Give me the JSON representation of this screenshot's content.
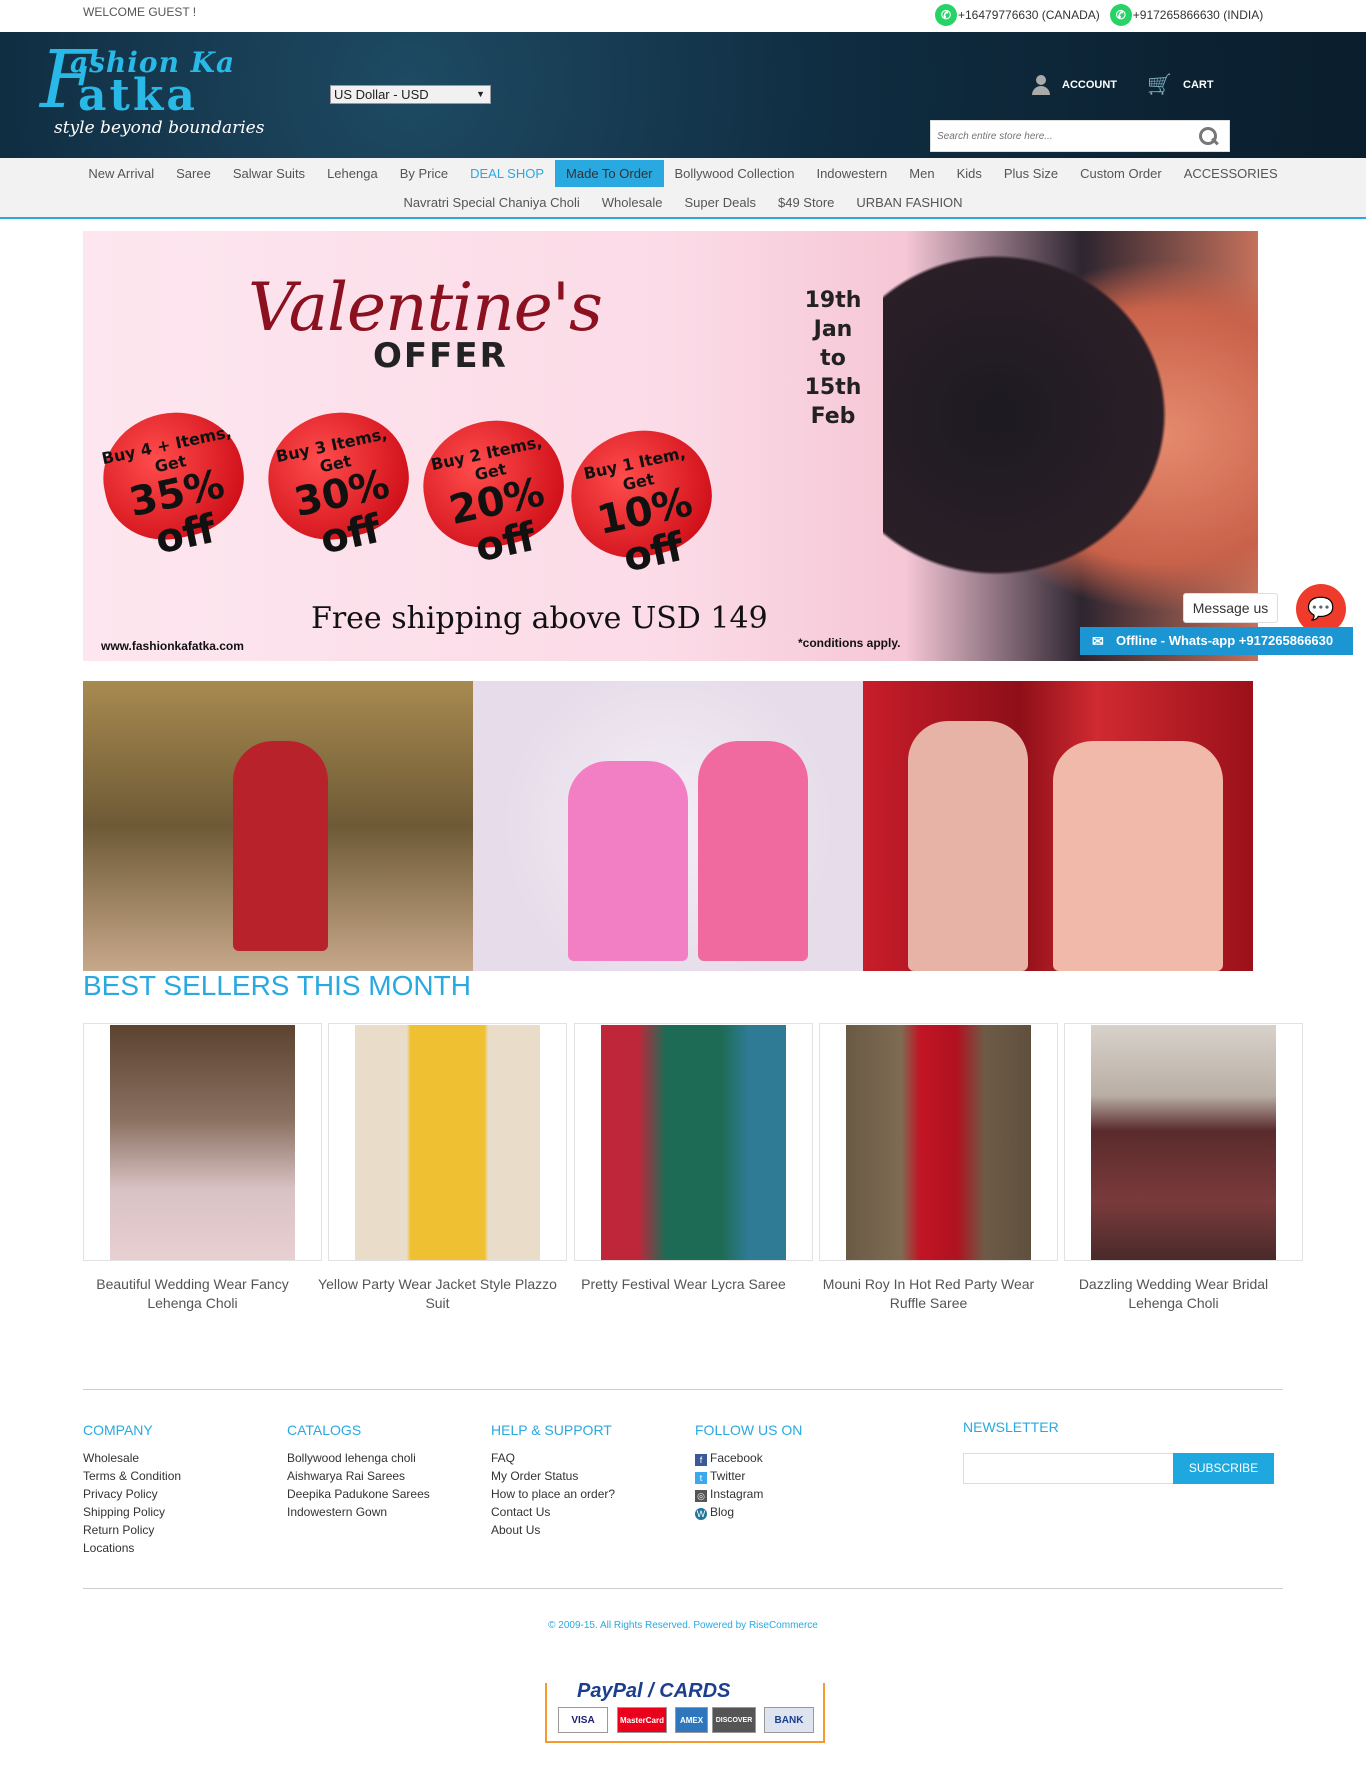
{
  "topbar": {
    "welcome": "WELCOME GUEST !",
    "phone_canada": "+16479776630 (CANADA)",
    "phone_india": "+917265866630 (INDIA)"
  },
  "header": {
    "logo_line1": "ashion Ka",
    "logo_line2": "atka",
    "logo_initial": "F",
    "logo_tagline": "style beyond boundaries",
    "currency": "US Dollar - USD",
    "account": "ACCOUNT",
    "cart": "CART",
    "search_placeholder": "Search entire store here..."
  },
  "nav": {
    "row1": [
      "New Arrival",
      "Saree",
      "Salwar Suits",
      "Lehenga",
      "By Price",
      "DEAL SHOP",
      "Made To Order",
      "Bollywood Collection",
      "Indowestern",
      "Men",
      "Kids",
      "Plus Size",
      "Custom Order",
      "ACCESSORIES"
    ],
    "row2": [
      "Navratri Special Chaniya Choli",
      "Wholesale",
      "Super Deals",
      "$49 Store",
      "URBAN FASHION"
    ]
  },
  "banner": {
    "title": "Valentine's",
    "subtitle": "OFFER",
    "date_line1": "19th Jan",
    "date_line2": "to",
    "date_line3": "15th Feb",
    "hearts": [
      {
        "label": "Buy 4 + Items, Get",
        "value": "35% off"
      },
      {
        "label": "Buy 3 Items, Get",
        "value": "30% off"
      },
      {
        "label": "Buy 2 Items, Get",
        "value": "20% off"
      },
      {
        "label": "Buy 1 Item, Get",
        "value": "10% off"
      }
    ],
    "free_shipping": "Free shipping above USD 149",
    "website": "www.fashionkafatka.com",
    "conditions": "*conditions apply."
  },
  "chat": {
    "message": "Message us",
    "offline": "Offline - Whats-app +917265866630"
  },
  "best_sellers": {
    "title": "BEST SELLERS THIS MONTH",
    "products": [
      "Beautiful Wedding Wear Fancy Lehenga Choli",
      "Yellow Party Wear Jacket Style Plazzo Suit",
      "Pretty Festival Wear Lycra Saree",
      "Mouni Roy In Hot Red Party Wear Ruffle Saree",
      "Dazzling Wedding Wear Bridal Lehenga Choli"
    ]
  },
  "footer": {
    "company": {
      "title": "COMPANY",
      "links": [
        "Wholesale",
        "Terms & Condition",
        "Privacy Policy",
        "Shipping Policy",
        "Return Policy",
        "Locations"
      ]
    },
    "catalogs": {
      "title": "CATALOGS",
      "links": [
        "Bollywood lehenga choli",
        "Aishwarya Rai Sarees",
        "Deepika Padukone Sarees",
        "Indowestern Gown"
      ]
    },
    "help": {
      "title": "HELP & SUPPORT",
      "links": [
        "FAQ",
        "My Order Status",
        "How to place an order?",
        "Contact Us",
        "About Us"
      ]
    },
    "follow": {
      "title": "FOLLOW US ON",
      "links": [
        "Facebook",
        "Twitter",
        "Instagram",
        "Blog"
      ]
    },
    "newsletter": {
      "title": "NEWSLETTER",
      "button": "SUBSCRIBE"
    },
    "copyright": "© 2009-15. All Rights Reserved. Powered by RiseCommerce",
    "payment": {
      "title": "PayPal / CARDS",
      "cards": [
        "VISA",
        "MasterCard",
        "AMEX",
        "DISCOVER",
        "BANK"
      ]
    }
  },
  "colors": {
    "accent": "#29a9e0",
    "header_bg": "#0f2c40"
  }
}
